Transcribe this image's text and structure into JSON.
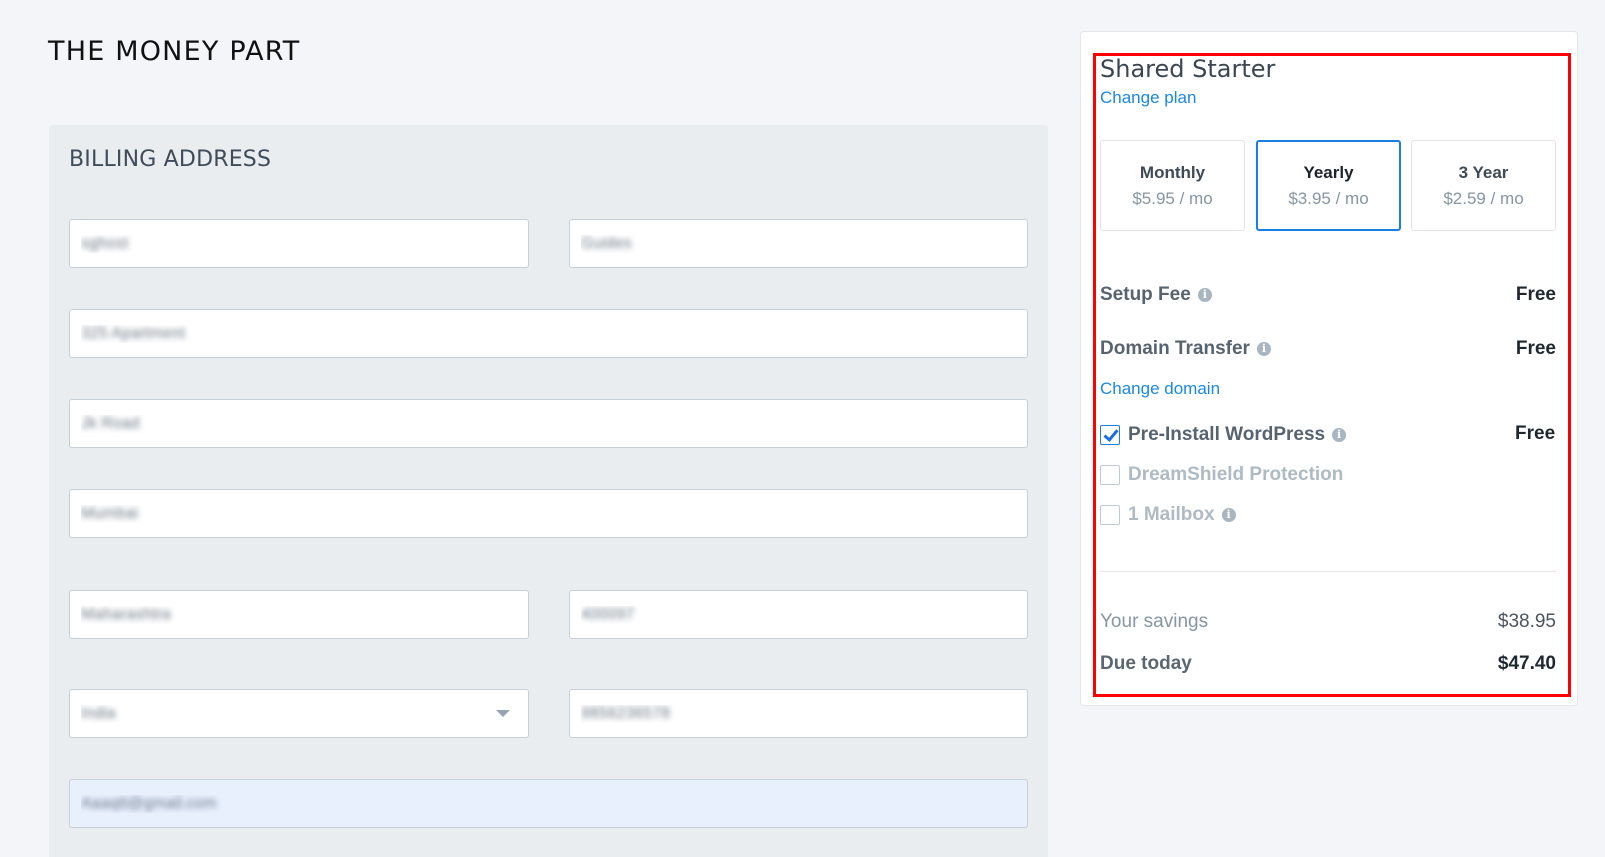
{
  "page": {
    "title": "THE MONEY PART"
  },
  "billing": {
    "section_title": "BILLING ADDRESS",
    "first_name": "sghost",
    "last_name": "Guides",
    "address_line1": "325 Apartment",
    "address_line2": "Jk Road",
    "city": "Mumbai",
    "state": "Maharashtra",
    "postal_code": "400097",
    "country": "India",
    "phone": "9856236578",
    "email": "Aaaqtt@gmail.com"
  },
  "order": {
    "plan_name": "Shared Starter",
    "change_plan_label": "Change plan",
    "terms": [
      {
        "name": "Monthly",
        "price": "$5.95 / mo",
        "selected": false
      },
      {
        "name": "Yearly",
        "price": "$3.95 / mo",
        "selected": true
      },
      {
        "name": "3 Year",
        "price": "$2.59 / mo",
        "selected": false
      }
    ],
    "setup_fee": {
      "label": "Setup Fee",
      "value": "Free",
      "icon": "info-icon"
    },
    "domain_transfer": {
      "label": "Domain Transfer",
      "value": "Free",
      "icon": "info-icon"
    },
    "change_domain_label": "Change domain",
    "addons": [
      {
        "label": "Pre-Install WordPress",
        "value": "Free",
        "checked": true,
        "enabled": true,
        "icon": "info-icon"
      },
      {
        "label": "DreamShield Protection",
        "value": "",
        "checked": false,
        "enabled": false
      },
      {
        "label": "1 Mailbox",
        "value": "",
        "checked": false,
        "enabled": false,
        "icon": "info-icon"
      }
    ],
    "savings": {
      "label": "Your savings",
      "value": "$38.95"
    },
    "due_today": {
      "label": "Due today",
      "value": "$47.40"
    }
  },
  "colors": {
    "accent": "#1a7fe0",
    "link": "#1a88e6",
    "highlight": "#ff0000",
    "panel_bg": "#e9edf0",
    "page_bg": "#f3f5f8"
  }
}
